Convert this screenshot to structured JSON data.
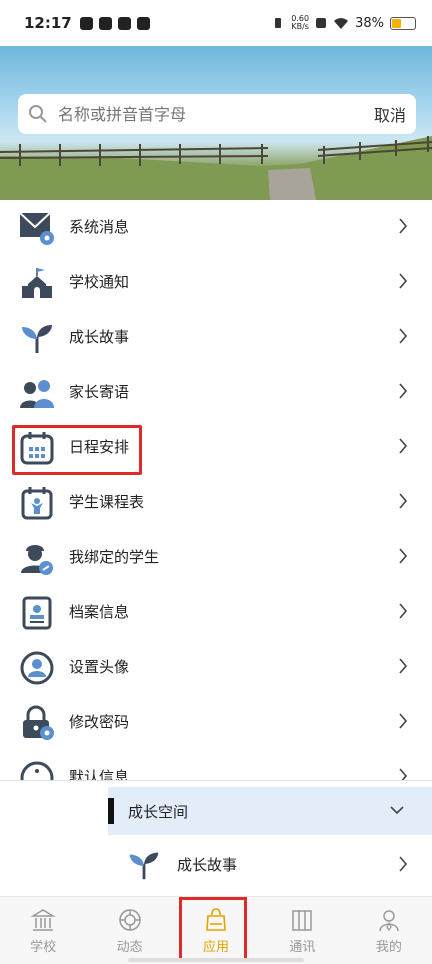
{
  "status_bar": {
    "time": "12:17",
    "net_speed": "0.60",
    "net_unit": "KB/s",
    "battery": "38%"
  },
  "search": {
    "placeholder": "名称或拼音首字母",
    "cancel_label": "取消"
  },
  "menu": {
    "items": [
      {
        "label": "系统消息",
        "icon": "mail-gear-icon"
      },
      {
        "label": "学校通知",
        "icon": "school-icon"
      },
      {
        "label": "成长故事",
        "icon": "sprout-icon"
      },
      {
        "label": "家长寄语",
        "icon": "parents-icon"
      },
      {
        "label": "日程安排",
        "icon": "calendar-icon"
      },
      {
        "label": "学生课程表",
        "icon": "timetable-icon"
      },
      {
        "label": "我绑定的学生",
        "icon": "student-link-icon"
      },
      {
        "label": "档案信息",
        "icon": "profile-card-icon"
      },
      {
        "label": "设置头像",
        "icon": "avatar-icon"
      },
      {
        "label": "修改密码",
        "icon": "lock-gear-icon"
      },
      {
        "label": "默认信息",
        "icon": "info-icon"
      }
    ]
  },
  "group": {
    "title": "成长空间",
    "items": [
      {
        "label": "成长故事",
        "icon": "sprout-icon"
      }
    ]
  },
  "tabs": [
    {
      "label": "学校",
      "icon": "school-building-icon"
    },
    {
      "label": "动态",
      "icon": "dynamic-icon"
    },
    {
      "label": "应用",
      "icon": "bag-icon",
      "active": true
    },
    {
      "label": "通讯",
      "icon": "contacts-icon"
    },
    {
      "label": "我的",
      "icon": "user-icon"
    }
  ],
  "colors": {
    "accent": "#e3a400",
    "highlight": "#e02a2a",
    "group_bg": "#e3edf9",
    "icon_dark": "#3d4a5c",
    "icon_blue": "#5b8fcf"
  }
}
